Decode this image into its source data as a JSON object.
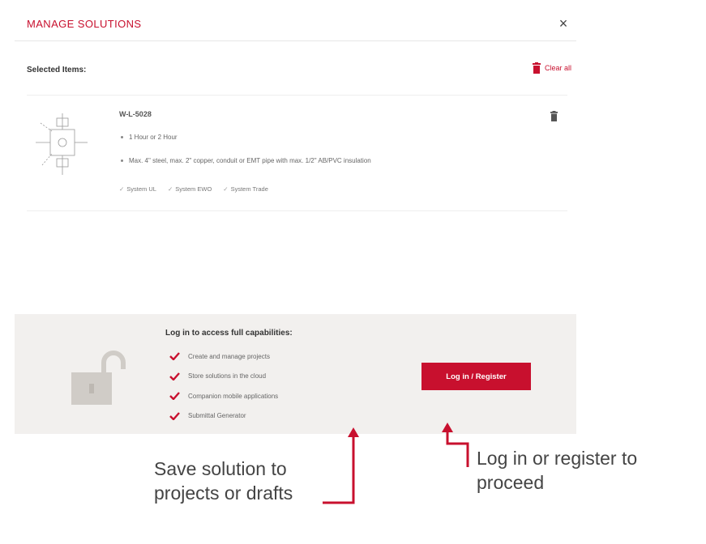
{
  "modal": {
    "title": "MANAGE SOLUTIONS",
    "close_glyph": "×",
    "selected_label": "Selected Items:",
    "clear_all_label": "Clear all"
  },
  "item": {
    "name": "W-L-5028",
    "bullets": [
      "1 Hour or 2 Hour",
      "Max. 4\" steel, max. 2\" copper, conduit or EMT pipe with max. 1/2\" AB/PVC insulation"
    ],
    "tags": [
      "System UL",
      "System EWO",
      "System Trade"
    ]
  },
  "login_panel": {
    "heading": "Log in to access full capabilities:",
    "features": [
      "Create and manage projects",
      "Store solutions in the cloud",
      "Companion mobile applications",
      "Submittal Generator"
    ],
    "button_label": "Log in / Register"
  },
  "annotations": {
    "save_note": "Save solution to projects or drafts",
    "login_note": "Log in or register to proceed"
  },
  "icons": {
    "close": "close-icon",
    "clear_all": "trash-icon",
    "item_delete": "trash-icon",
    "lock": "unlocked-padlock-icon",
    "feature_check": "checkmark-icon"
  },
  "colors": {
    "accent": "#c8102e",
    "panel_background": "#f2f0ee",
    "lock_icon": "#d0ccc7"
  }
}
